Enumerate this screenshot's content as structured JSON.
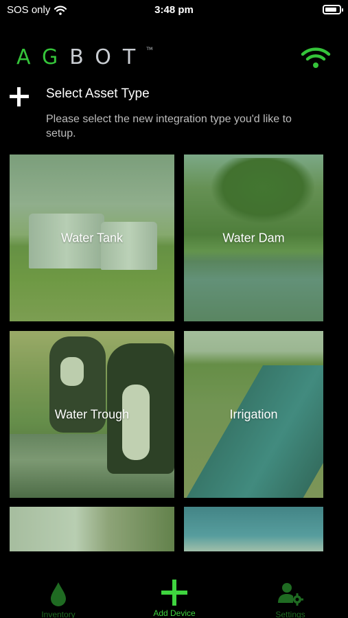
{
  "status_bar": {
    "carrier": "SOS only",
    "time": "3:48 pm",
    "battery_level": 0.85
  },
  "header": {
    "logo_part1": "AG",
    "logo_part2": "BOT",
    "logo_tm": "TM",
    "connection_icon": "wifi-icon",
    "accent_color": "#35c43a"
  },
  "section": {
    "title": "Select Asset Type",
    "description": "Please select the new integration type you'd like to setup."
  },
  "assets": [
    {
      "label": "Water Tank"
    },
    {
      "label": "Water Dam"
    },
    {
      "label": "Water Trough"
    },
    {
      "label": "Irrigation"
    }
  ],
  "tabbar": {
    "inventory_label": "Inventory",
    "add_device_label": "Add Device",
    "settings_label": "Settings",
    "active_color": "#3fd43f",
    "inactive_color": "#1f6b22"
  }
}
